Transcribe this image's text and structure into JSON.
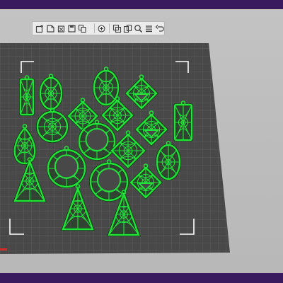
{
  "app": {
    "accent_color": "#3b1b63",
    "build_plate_color": "#4a4a4a",
    "grid_line_color": "#5e5e5e",
    "model_color": "#22e23a",
    "model_outline_color": "#0c3a0c",
    "corner_mark_color": "#ffffff",
    "axis_marker_color": "#d42a2a"
  },
  "toolbar": {
    "buttons": [
      {
        "icon": "add-object-icon"
      },
      {
        "icon": "open-file-icon"
      },
      {
        "icon": "delete-icon"
      },
      {
        "icon": "save-icon"
      },
      {
        "icon": "copy-icon"
      },
      {
        "icon": "add-icon"
      },
      {
        "icon": "arrange-icon"
      },
      {
        "icon": "duplicate-icon"
      },
      {
        "icon": "zoom-icon"
      },
      {
        "icon": "layers-icon"
      },
      {
        "icon": "undo-icon"
      }
    ]
  },
  "scene": {
    "models": [
      {
        "shape": "rect-tall"
      },
      {
        "shape": "oval"
      },
      {
        "shape": "oval"
      },
      {
        "shape": "diamond"
      },
      {
        "shape": "kite"
      },
      {
        "shape": "circle"
      },
      {
        "shape": "diamond"
      },
      {
        "shape": "rect-tall"
      },
      {
        "shape": "teardrop"
      },
      {
        "shape": "hoop"
      },
      {
        "shape": "kite"
      },
      {
        "shape": "diamond"
      },
      {
        "shape": "oval"
      },
      {
        "shape": "triangle"
      },
      {
        "shape": "hoop"
      },
      {
        "shape": "hoop"
      },
      {
        "shape": "kite"
      },
      {
        "shape": "triangle"
      },
      {
        "shape": "triangle"
      }
    ]
  }
}
